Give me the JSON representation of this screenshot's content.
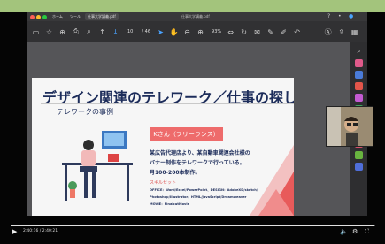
{
  "window": {
    "tab_home": "ホーム",
    "tab_tools": "ツール",
    "tab_file": "仕事大学講義.pdf",
    "title": "仕事大学講義.pdf"
  },
  "toolbar": {
    "page_current": "10",
    "page_total": "/ 46",
    "zoom": "93%"
  },
  "slide": {
    "title": "デザイン関連のテレワーク／仕事の探し方",
    "subtitle": "テレワークの事例",
    "person": "Kさん（フリーランス）",
    "desc": [
      "某広告代理店より、某自動車関連会社様の",
      "バナー制作をテレワークで行っている。",
      "月100-200本制作。"
    ],
    "skill_title": "スキルセット",
    "skills": [
      "OFFICE：Word/Excel/PowerPoint、DESIGN：AdobeXD/sketch/",
      "Photoshop/Illustrator、HTML/JavaScript/Dreamweaver",
      "MOVIE：FinalcutMovie"
    ]
  },
  "video": {
    "time": "2:40:16 / 2:40:21",
    "progress_pct": 99.7
  },
  "colors": {
    "accent_band": "#a3c47c",
    "slide_title": "#1c2c5a",
    "pink": "#ee6b6b"
  },
  "icons": {
    "play": "play-icon",
    "volume": "volume-icon",
    "settings": "gear-icon",
    "fullscreen": "fullscreen-icon"
  }
}
